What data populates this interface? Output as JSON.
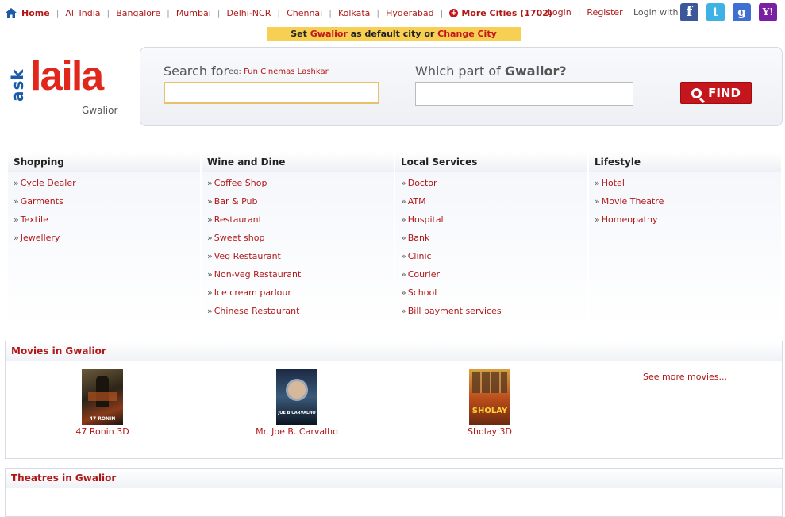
{
  "topnav": {
    "home": "Home",
    "cities": [
      "All India",
      "Bangalore",
      "Mumbai",
      "Delhi-NCR",
      "Chennai",
      "Kolkata",
      "Hyderabad"
    ],
    "more_cities": "More Cities (1702)"
  },
  "auth": {
    "login": "Login",
    "register": "Register",
    "login_with": "Login with"
  },
  "social": {
    "facebook": "f",
    "twitter": "t",
    "google": "g",
    "yahoo": "Y!"
  },
  "citybar": {
    "set": "Set",
    "city": "Gwalior",
    "as_default": "as default city or",
    "change": "Change City"
  },
  "logo": {
    "ask": "ask",
    "laila": "laila",
    "city": "Gwalior"
  },
  "search": {
    "search_for": "Search for",
    "eg_prefix": "eg:",
    "eg_value": "Fun Cinemas Lashkar",
    "which_part": "Which part of",
    "which_city": "Gwalior?",
    "find": "FIND"
  },
  "categories": [
    {
      "title": "Shopping",
      "items": [
        "Cycle Dealer",
        "Garments",
        "Textile",
        "Jewellery"
      ]
    },
    {
      "title": "Wine and Dine",
      "items": [
        "Coffee Shop",
        "Bar & Pub",
        "Restaurant",
        "Sweet shop",
        "Veg Restaurant",
        "Non-veg Restaurant",
        "Ice cream parlour",
        "Chinese Restaurant"
      ]
    },
    {
      "title": "Local Services",
      "items": [
        "Doctor",
        "ATM",
        "Hospital",
        "Bank",
        "Clinic",
        "Courier",
        "School",
        "Bill payment services"
      ]
    },
    {
      "title": "Lifestyle",
      "items": [
        "Hotel",
        "Movie Theatre",
        "Homeopathy"
      ]
    }
  ],
  "movies": {
    "title": "Movies in Gwalior",
    "items": [
      {
        "title": "47 Ronin 3D",
        "poster_text": "47 RONIN"
      },
      {
        "title": "Mr. Joe B. Carvalho",
        "poster_text": "JOE B CARVALHO"
      },
      {
        "title": "Sholay 3D",
        "poster_text": "SHOLAY"
      }
    ],
    "see_more": "See more movies..."
  },
  "theatres": {
    "title": "Theatres in Gwalior"
  },
  "colors": {
    "brand_red": "#c4161c",
    "link_red": "#b01818",
    "brand_blue": "#1c5aa8",
    "citybar_yellow": "#f7cf53"
  }
}
